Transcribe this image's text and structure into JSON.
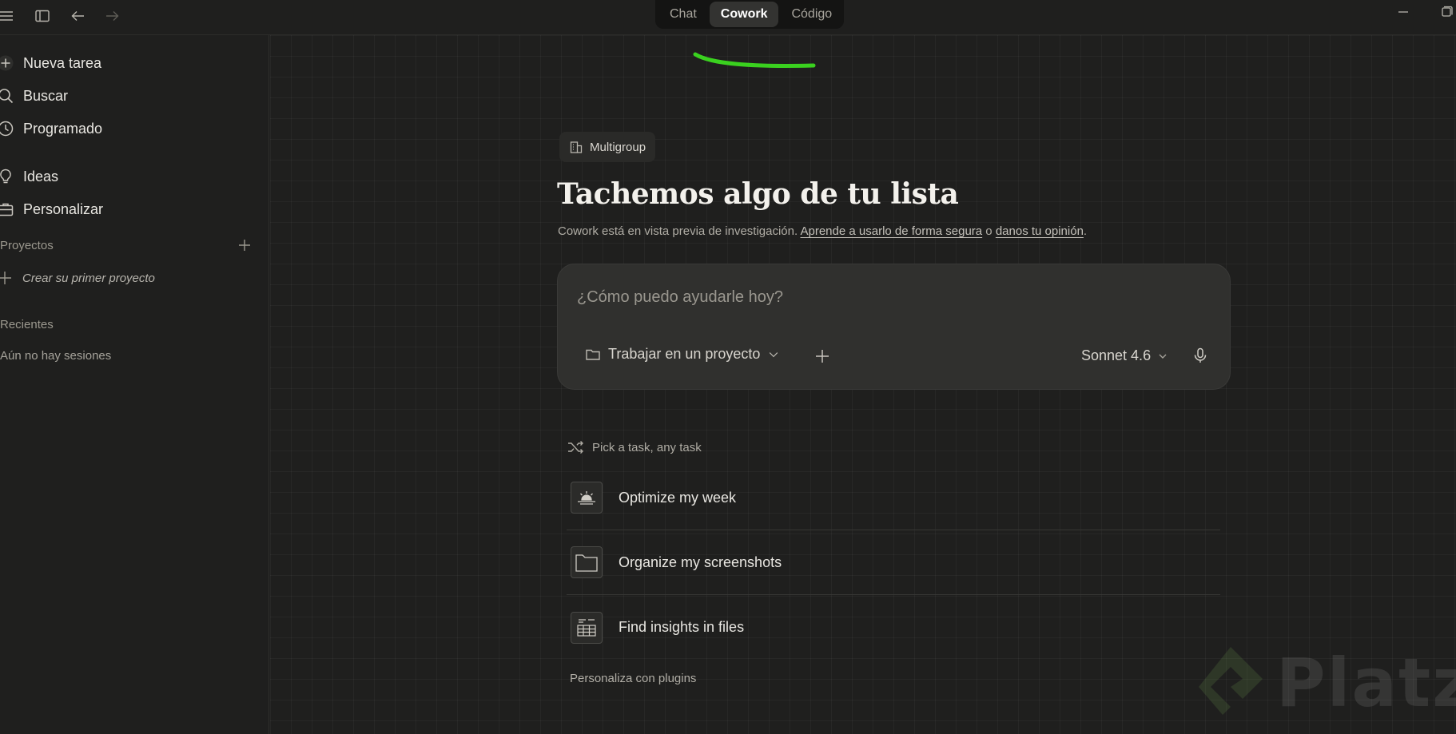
{
  "modes": {
    "chat": "Chat",
    "cowork": "Cowork",
    "code": "Código",
    "active": "Cowork"
  },
  "sidebar": {
    "items": [
      {
        "label": "Nueva tarea",
        "icon": "plus-icon"
      },
      {
        "label": "Buscar",
        "icon": "search-icon"
      },
      {
        "label": "Programado",
        "icon": "clock-icon"
      },
      {
        "label": "Ideas",
        "icon": "lightbulb-icon"
      },
      {
        "label": "Personalizar",
        "icon": "briefcase-icon"
      }
    ],
    "projects_label": "Proyectos",
    "create_project": "Crear su primer proyecto",
    "recents_label": "Recientes",
    "no_sessions": "Aún no hay sesiones"
  },
  "main": {
    "org_badge": "Multigroup",
    "headline": "Tachemos algo de tu lista",
    "subtext": {
      "before": "Cowork está en vista previa de investigación. ",
      "link1": "Aprende a usarlo de forma segura",
      "middle": " o ",
      "link2": "danos tu opinión",
      "after": "."
    },
    "composer": {
      "placeholder": "¿Cómo puedo ayudarle hoy?",
      "project_select": "Trabajar en un proyecto",
      "model": "Sonnet 4.6"
    },
    "pick_task": "Pick a task, any task",
    "tasks": [
      {
        "label": "Optimize my week",
        "icon": "sunrise-icon"
      },
      {
        "label": "Organize my screenshots",
        "icon": "folder-icon"
      },
      {
        "label": "Find insights in files",
        "icon": "spreadsheet-icon"
      }
    ],
    "plugins_link": "Personaliza con plugins"
  },
  "watermark": {
    "text": "Platzi"
  },
  "colors": {
    "accent_stroke": "#3ad11f",
    "background": "#1f1f1e",
    "composer": "#30302e"
  }
}
